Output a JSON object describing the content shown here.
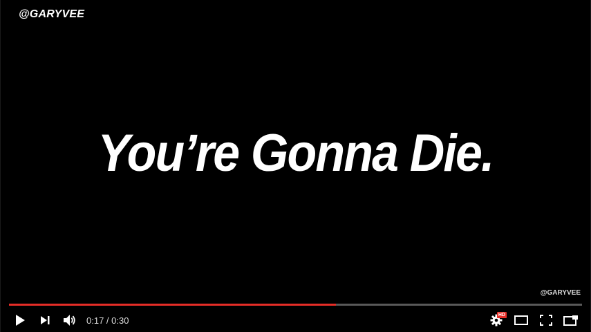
{
  "video": {
    "watermark_top": "@GARYVEE",
    "headline": "You’re Gonna Die.",
    "watermark_bottom": "@GARYVEE"
  },
  "player": {
    "progress_percent": 57,
    "progress_color": "#e52d27",
    "time_display": "0:17 / 0:30",
    "hd_badge": "HD",
    "icons": [
      "play-icon",
      "next-icon",
      "volume-icon",
      "settings-icon",
      "theater-mode-icon",
      "fullscreen-icon",
      "miniplayer-icon"
    ]
  }
}
